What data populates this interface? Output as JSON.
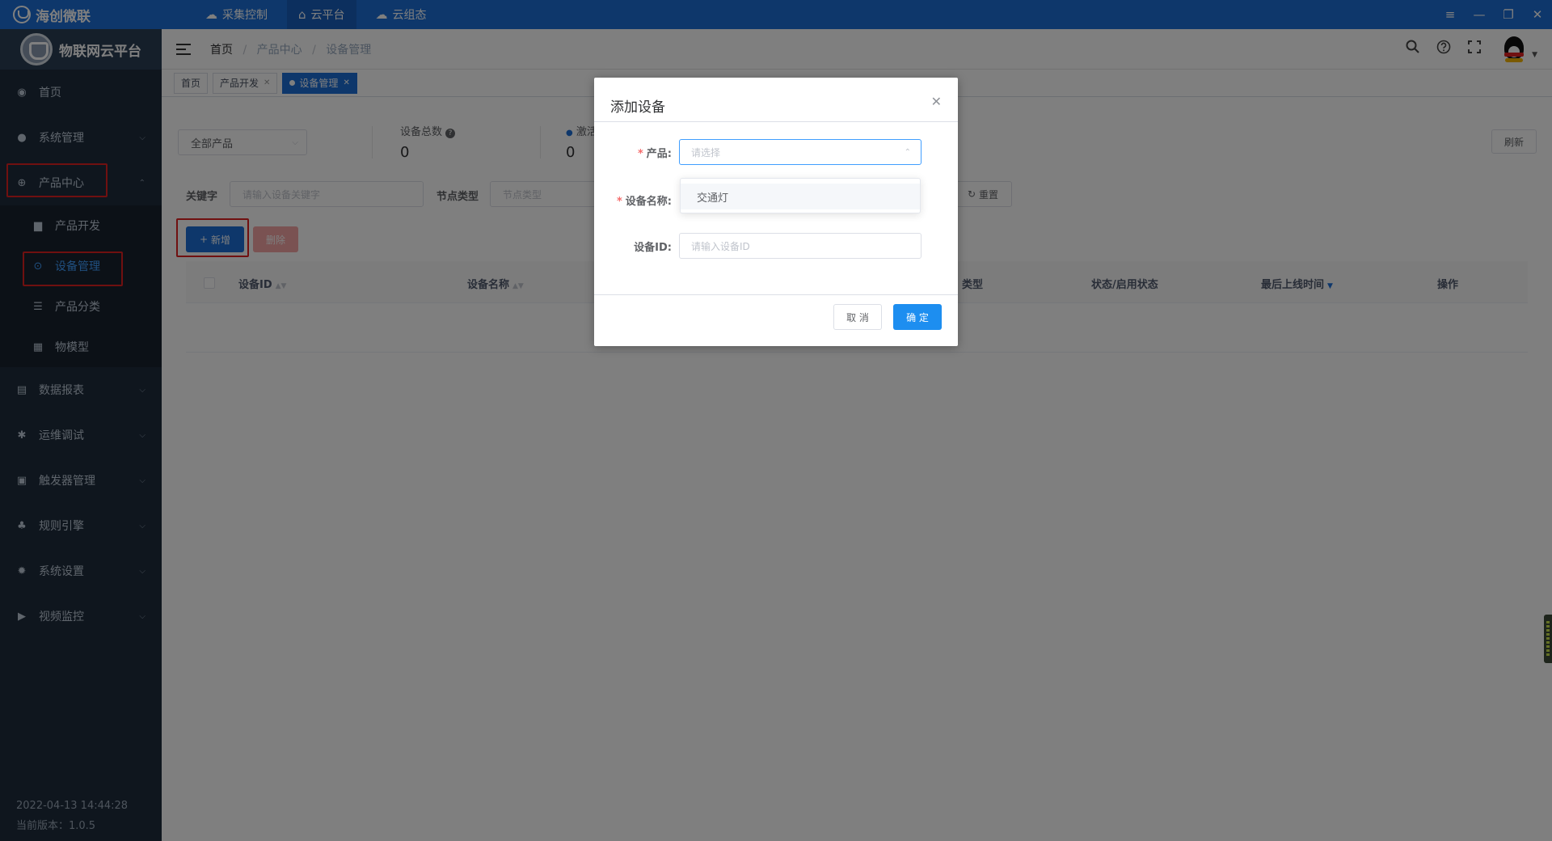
{
  "topbar": {
    "brand": "海创微联",
    "tabs": [
      {
        "label": "采集控制",
        "icon": "cloud-gear-icon"
      },
      {
        "label": "云平台",
        "icon": "cloud-home-icon"
      },
      {
        "label": "云组态",
        "icon": "cloud-icon"
      }
    ],
    "window_controls": {
      "menu": "≡",
      "minimize": "—",
      "restore": "❐",
      "close": "✕"
    }
  },
  "sidebar": {
    "title": "物联网云平台",
    "menu": [
      {
        "label": "首页",
        "icon": "dashboard-icon"
      },
      {
        "label": "系统管理",
        "icon": "user-icon"
      },
      {
        "label": "产品中心",
        "icon": "product-icon"
      },
      {
        "label": "数据报表",
        "icon": "report-icon"
      },
      {
        "label": "运维调试",
        "icon": "bug-icon"
      },
      {
        "label": "触发器管理",
        "icon": "trigger-icon"
      },
      {
        "label": "规则引擎",
        "icon": "tree-icon"
      },
      {
        "label": "系统设置",
        "icon": "gear-icon"
      },
      {
        "label": "视频监控",
        "icon": "camera-icon"
      }
    ],
    "submenu": [
      {
        "label": "产品开发",
        "icon": "folder-icon"
      },
      {
        "label": "设备管理",
        "icon": "device-icon"
      },
      {
        "label": "产品分类",
        "icon": "list-icon"
      },
      {
        "label": "物模型",
        "icon": "grid-icon"
      }
    ],
    "footer": {
      "datetime": "2022-04-13 14:44:28",
      "version": "当前版本：1.0.5"
    }
  },
  "breadcrumb": [
    "首页",
    "产品中心",
    "设备管理"
  ],
  "tags": [
    "首页",
    "产品开发",
    "设备管理"
  ],
  "filters": {
    "product_select": "全部产品",
    "stat_total_label": "设备总数",
    "stat_total_value": "0",
    "stat_active_label": "激活",
    "stat_active_value": "0",
    "refresh": "刷新",
    "keyword_label": "关键字",
    "keyword_placeholder": "请输入设备关键字",
    "node_type_label": "节点类型",
    "node_type_placeholder": "节点类型",
    "reset": "重置",
    "add": "新增",
    "delete": "删除"
  },
  "table": {
    "columns": [
      "设备ID",
      "设备名称",
      "类型",
      "状态/启用状态",
      "最后上线时间",
      "操作"
    ]
  },
  "dialog": {
    "title": "添加设备",
    "product_label": "产品:",
    "product_placeholder": "请选择",
    "name_label": "设备名称:",
    "id_label": "设备ID:",
    "id_placeholder": "请输入设备ID",
    "option": "交通灯",
    "cancel": "取 消",
    "confirm": "确 定"
  }
}
